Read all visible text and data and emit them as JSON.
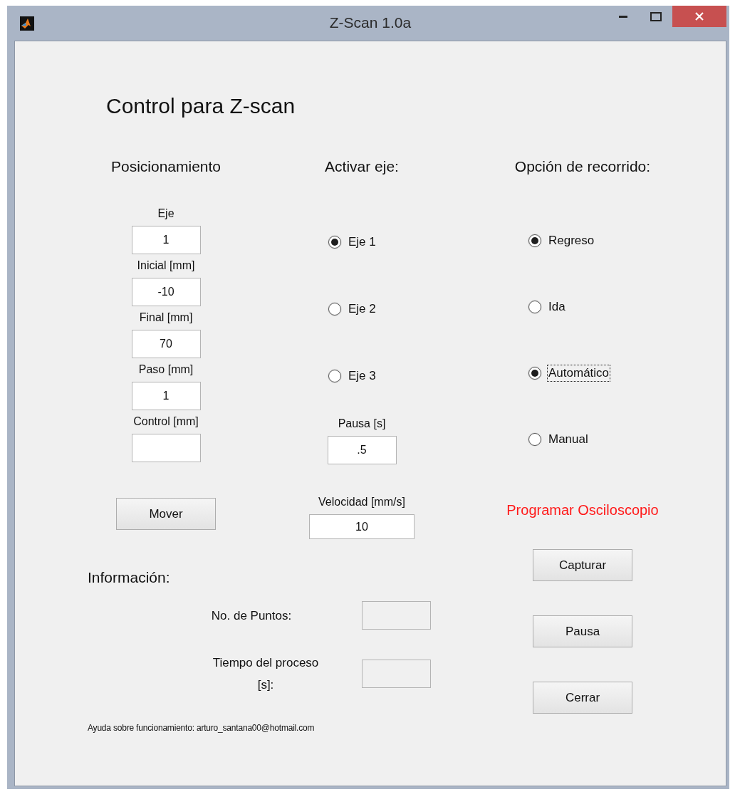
{
  "window": {
    "title": "Z-Scan 1.0a"
  },
  "heading": "Control para Z-scan",
  "positioning": {
    "title": "Posicionamiento",
    "fields": [
      {
        "label": "Eje",
        "value": "1"
      },
      {
        "label": "Inicial [mm]",
        "value": "-10"
      },
      {
        "label": "Final [mm]",
        "value": "70"
      },
      {
        "label": "Paso [mm]",
        "value": "1"
      },
      {
        "label": "Control [mm]"
      }
    ],
    "button": "Mover"
  },
  "axis": {
    "title": "Activar eje:",
    "options": [
      {
        "label": "Eje 1",
        "selected": true
      },
      {
        "label": "Eje 2",
        "selected": false
      },
      {
        "label": "Eje 3",
        "selected": false
      }
    ],
    "fields": [
      {
        "label": "Pausa [s]",
        "value": ".5"
      },
      {
        "label": "Velocidad [mm/s]",
        "value": "10"
      }
    ]
  },
  "route": {
    "title": "Opción de recorrido:",
    "options": [
      {
        "label": "Regreso",
        "selected": true,
        "focused": false
      },
      {
        "label": "Ida",
        "selected": false,
        "focused": false
      },
      {
        "label": "Automático",
        "selected": true,
        "focused": true
      },
      {
        "label": "Manual",
        "selected": false,
        "focused": false
      }
    ]
  },
  "oscilloscope": {
    "title": "Programar Osciloscopio",
    "buttons": [
      "Capturar",
      "Pausa",
      "Cerrar"
    ]
  },
  "info": {
    "title": "Información:",
    "fields": [
      {
        "label": "No. de Puntos:"
      },
      {
        "label": "Tiempo del proceso [s]:"
      }
    ]
  },
  "footer": "Ayuda sobre funcionamiento: arturo_santana00@hotmail.com"
}
